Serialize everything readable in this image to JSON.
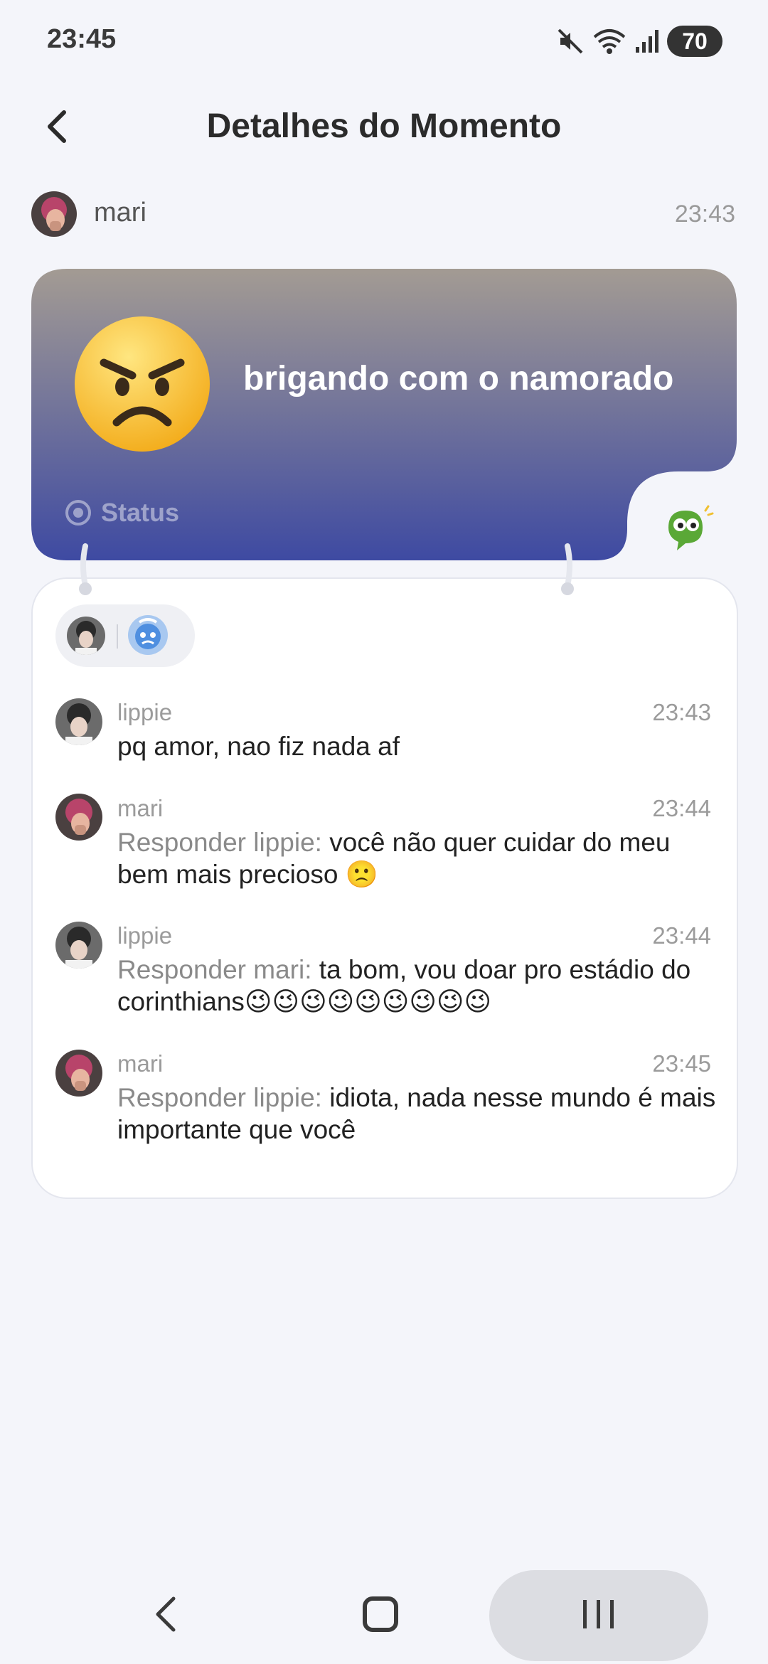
{
  "status_bar": {
    "time": "23:45",
    "battery": "70"
  },
  "header": {
    "title": "Detalhes do Momento"
  },
  "post": {
    "author": "mari",
    "time": "23:43",
    "status_text": "brigando com o namorado",
    "status_label": "Status"
  },
  "comments": [
    {
      "name": "lippie",
      "time": "23:43",
      "reply_prefix": "",
      "text": "pq amor, nao fiz nada af"
    },
    {
      "name": "mari",
      "time": "23:44",
      "reply_prefix": "Responder lippie: ",
      "text": "você não quer cuidar do meu bem mais precioso 🙁"
    },
    {
      "name": "lippie",
      "time": "23:44",
      "reply_prefix": "Responder mari: ",
      "text": "ta bom, vou doar pro estádio do corinthians😉😉😉😉😉😉😉😉😉"
    },
    {
      "name": "mari",
      "time": "23:45",
      "reply_prefix": "Responder lippie: ",
      "text": "idiota, nada nesse mundo é mais importante que você"
    }
  ],
  "colors": {
    "card_top": "#a39b93",
    "card_bottom": "#3e4aa2",
    "background": "#f4f5fa"
  }
}
